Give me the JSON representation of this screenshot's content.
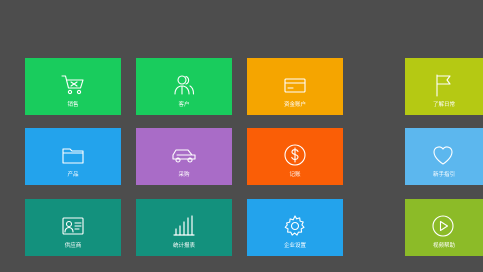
{
  "tiles": [
    {
      "label": "销售",
      "color": "#19cc5d",
      "icon": "shopping-cart-icon"
    },
    {
      "label": "客户",
      "color": "#19cc5d",
      "icon": "customers-icon"
    },
    {
      "label": "资金账户",
      "color": "#f5a500",
      "icon": "credit-card-icon"
    },
    {
      "label": "了解日常",
      "color": "#b5c913",
      "icon": "flag-icon"
    },
    {
      "label": "产品",
      "color": "#23a3ec",
      "icon": "folder-icon"
    },
    {
      "label": "采购",
      "color": "#a96cc7",
      "icon": "truck-icon"
    },
    {
      "label": "记账",
      "color": "#fa5e06",
      "icon": "dollar-icon"
    },
    {
      "label": "新手指引",
      "color": "#5cb7ee",
      "icon": "heart-icon"
    },
    {
      "label": "供应商",
      "color": "#13917d",
      "icon": "supplier-card-icon"
    },
    {
      "label": "统计报表",
      "color": "#13917d",
      "icon": "bar-chart-icon"
    },
    {
      "label": "企业设置",
      "color": "#23a3ec",
      "icon": "settings-gear-icon"
    },
    {
      "label": "视频帮助",
      "color": "#8cbb28",
      "icon": "play-circle-icon"
    }
  ]
}
